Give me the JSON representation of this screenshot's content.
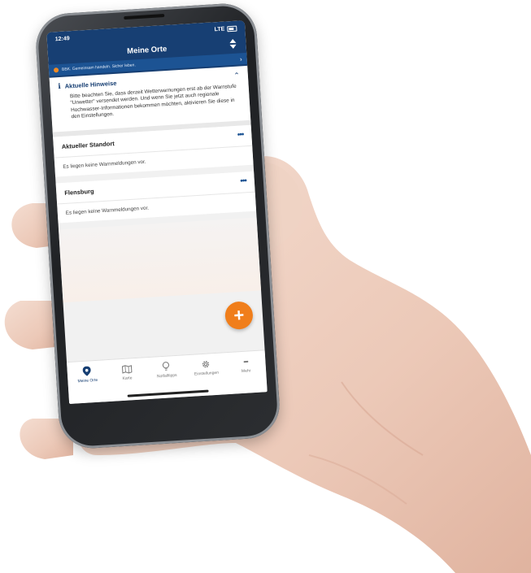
{
  "status": {
    "time": "12:49",
    "network": "LTE"
  },
  "header": {
    "title": "Meine Orte"
  },
  "banner": {
    "text": "BBK. Gemeinsam handeln. Sicher leben."
  },
  "hint": {
    "title": "Aktuelle Hinweise",
    "text": "Bitte beachten Sie, dass derzeit Wetterwarnungen erst ab der Warnstufe \"Unwetter\" versendet werden. Und wenn Sie jetzt auch regionale Hochwasser-Informationen bekommen möchten, aktivieren Sie diese in den Einstellungen."
  },
  "locations": [
    {
      "name": "Aktueller Standort",
      "message": "Es liegen keine Warnmeldungen vor."
    },
    {
      "name": "Flensburg",
      "message": "Es liegen keine Warnmeldungen vor."
    }
  ],
  "tabs": [
    {
      "label": "Meine Orte",
      "icon": "location-pin-icon"
    },
    {
      "label": "Karte",
      "icon": "map-icon"
    },
    {
      "label": "Notfalltipps",
      "icon": "lightbulb-icon"
    },
    {
      "label": "Einstellungen",
      "icon": "gear-icon"
    },
    {
      "label": "Mehr",
      "icon": "more-dots-icon"
    }
  ],
  "colors": {
    "header": "#173f73",
    "banner": "#1c5393",
    "fab": "#f07e1b"
  }
}
